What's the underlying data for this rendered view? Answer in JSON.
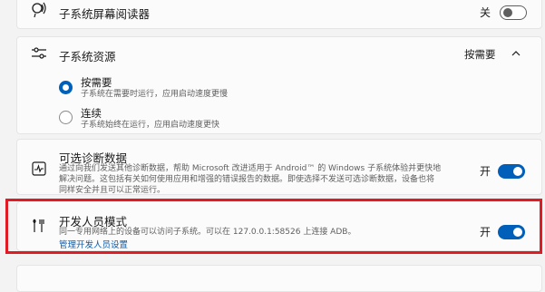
{
  "screen_reader": {
    "title": "子系统屏幕阅读器",
    "state": "关"
  },
  "resources": {
    "title": "子系统资源",
    "value": "按需要",
    "options": [
      {
        "title": "按需要",
        "desc": "子系统在需要时运行，应用启动速度更慢",
        "selected": true
      },
      {
        "title": "连续",
        "desc": "子系统始终在运行，应用启动速度更快",
        "selected": false
      }
    ]
  },
  "diagnostics": {
    "title": "可选诊断数据",
    "desc_line1": "通过向我们发送其他诊断数据，帮助 Microsoft 改进适用于 Android™ 的 Windows 子系统体验并更快地",
    "desc_line2": "解决问题。这包括有关如何使用应用和增强的错误报告的数据。即使选择不发送可选诊断数据，设备也将",
    "desc_line3": "同样安全并且可以正常运行。",
    "state": "开"
  },
  "developer": {
    "title": "开发人员模式",
    "desc": "同一专用网络上的设备可以访问子系统。可以在 127.0.0.1:58526 上连接 ADB。",
    "link": "管理开发人员设置",
    "state": "开"
  },
  "icons": [
    "screen-reader-icon",
    "sliders-icon",
    "chevron-up-icon",
    "diagnostics-icon",
    "developer-tools-icon"
  ],
  "colors": {
    "accent": "#005fb8",
    "highlight": "#e01b24"
  }
}
